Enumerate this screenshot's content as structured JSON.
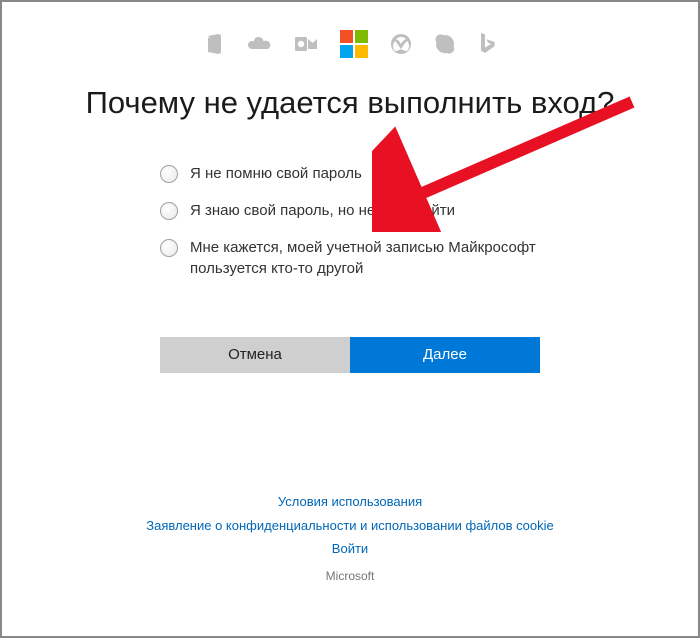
{
  "header": {
    "services": [
      {
        "name": "office-icon"
      },
      {
        "name": "onedrive-icon"
      },
      {
        "name": "outlook-icon"
      },
      {
        "name": "microsoft-logo"
      },
      {
        "name": "xbox-icon"
      },
      {
        "name": "skype-icon"
      },
      {
        "name": "bing-icon"
      }
    ]
  },
  "title": "Почему не удается выполнить вход?",
  "options": [
    {
      "id": "forgot-password",
      "label": "Я не помню свой пароль"
    },
    {
      "id": "know-password-cant-signin",
      "label": "Я знаю свой пароль, но не могу войти"
    },
    {
      "id": "someone-else-using",
      "label": "Мне кажется, моей учетной записью Майкрософт пользуется кто-то другой"
    }
  ],
  "buttons": {
    "cancel": "Отмена",
    "next": "Далее"
  },
  "footer": {
    "terms": "Условия использования",
    "privacy": "Заявление о конфиденциальности и использовании файлов cookie",
    "signin": "Войти",
    "company": "Microsoft"
  }
}
